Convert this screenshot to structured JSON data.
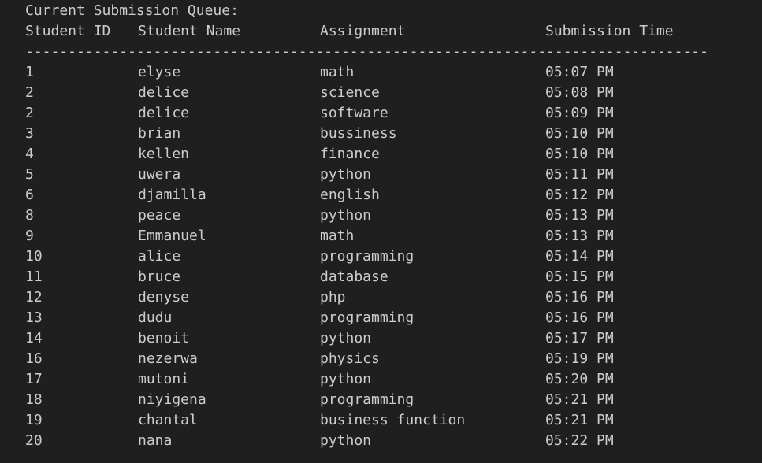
{
  "title": "Current Submission Queue:",
  "headers": [
    "Student ID",
    "Student Name",
    "Assignment",
    "Submission Time"
  ],
  "separator": "--------------------------------------------------------------------------------",
  "rows": [
    [
      "1",
      "elyse",
      "math",
      "05:07 PM"
    ],
    [
      "2",
      "delice",
      "science",
      "05:08 PM"
    ],
    [
      "2",
      "delice",
      "software",
      "05:09 PM"
    ],
    [
      "3",
      "brian",
      "bussiness",
      "05:10 PM"
    ],
    [
      "4",
      "kellen",
      "finance",
      "05:10 PM"
    ],
    [
      "5",
      "uwera",
      "python",
      "05:11 PM"
    ],
    [
      "6",
      "djamilla",
      "english",
      "05:12 PM"
    ],
    [
      "8",
      "peace",
      "python",
      "05:13 PM"
    ],
    [
      "9",
      "Emmanuel",
      "math",
      "05:13 PM"
    ],
    [
      "10",
      "alice",
      "programming",
      "05:14 PM"
    ],
    [
      "11",
      "bruce",
      "database",
      "05:15 PM"
    ],
    [
      "12",
      "denyse",
      "php",
      "05:16 PM"
    ],
    [
      "13",
      "dudu",
      "programming",
      "05:16 PM"
    ],
    [
      "14",
      "benoit",
      "python",
      "05:17 PM"
    ],
    [
      "16",
      "nezerwa",
      "physics",
      "05:19 PM"
    ],
    [
      "17",
      "mutoni",
      "python",
      "05:20 PM"
    ],
    [
      "18",
      "niyigena",
      "programming",
      "05:21 PM"
    ],
    [
      "19",
      "chantal",
      "business function",
      "05:21 PM"
    ],
    [
      "20",
      "nana",
      "python",
      "05:22 PM"
    ]
  ]
}
